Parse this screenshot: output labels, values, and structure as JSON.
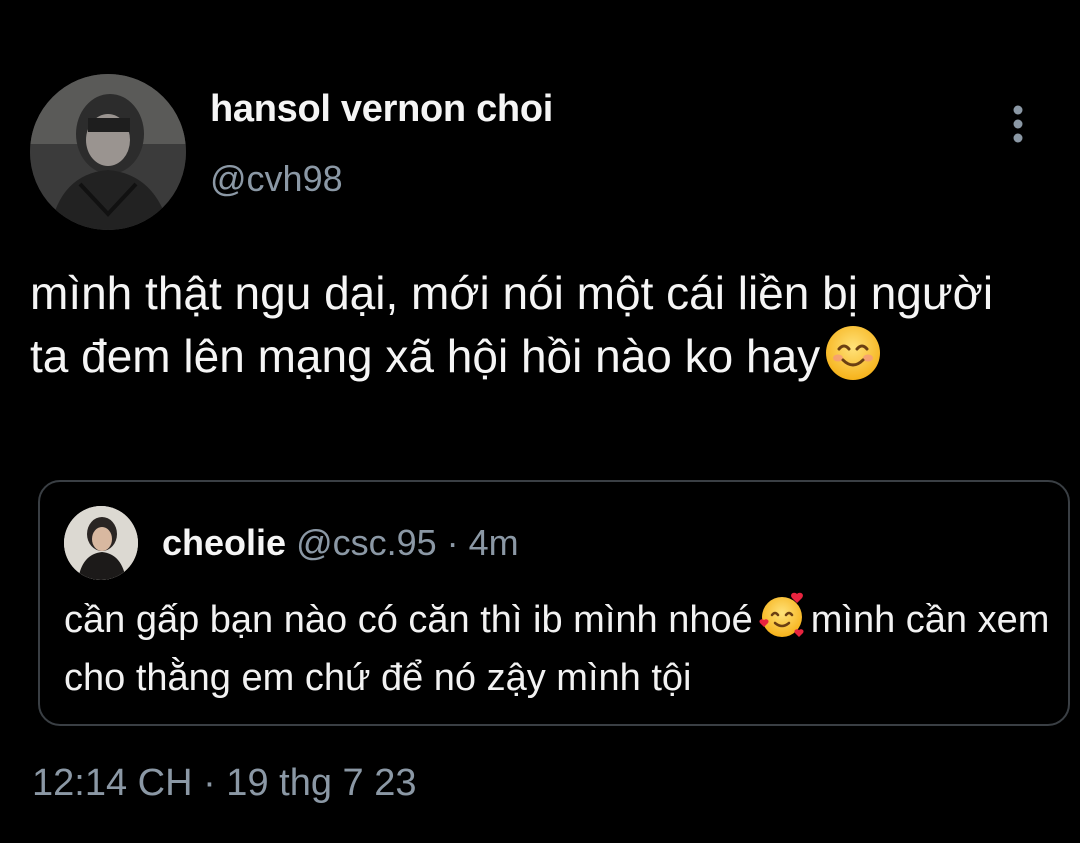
{
  "tweet": {
    "author": {
      "display_name": "hansol vernon choi",
      "handle": "@cvh98",
      "avatar": "user-avatar-photo"
    },
    "more_icon": "vertical-ellipsis-icon",
    "text": "mình thật ngu dại, mới nói một cái liền bị người ta đem lên mạng xã hội hồi nào ko hay",
    "text_emoji": "smiling-face-icon",
    "quoted": {
      "avatar": "quoted-user-avatar-photo",
      "display_name": "cheolie",
      "meta": "@csc.95 · 4m",
      "text_part1": "cần gấp bạn nào có căn thì ib mình nhoé",
      "emoji": "smiling-face-with-hearts-icon",
      "text_part2": "mình cần xem cho thằng em chứ để nó zậy mình tội"
    },
    "timestamp": "12:14 CH · 19 thg 7 23"
  },
  "colors": {
    "background": "#000000",
    "text": "#f5f5f5",
    "secondary_text": "#8b98a5",
    "border": "#3a3f44"
  }
}
